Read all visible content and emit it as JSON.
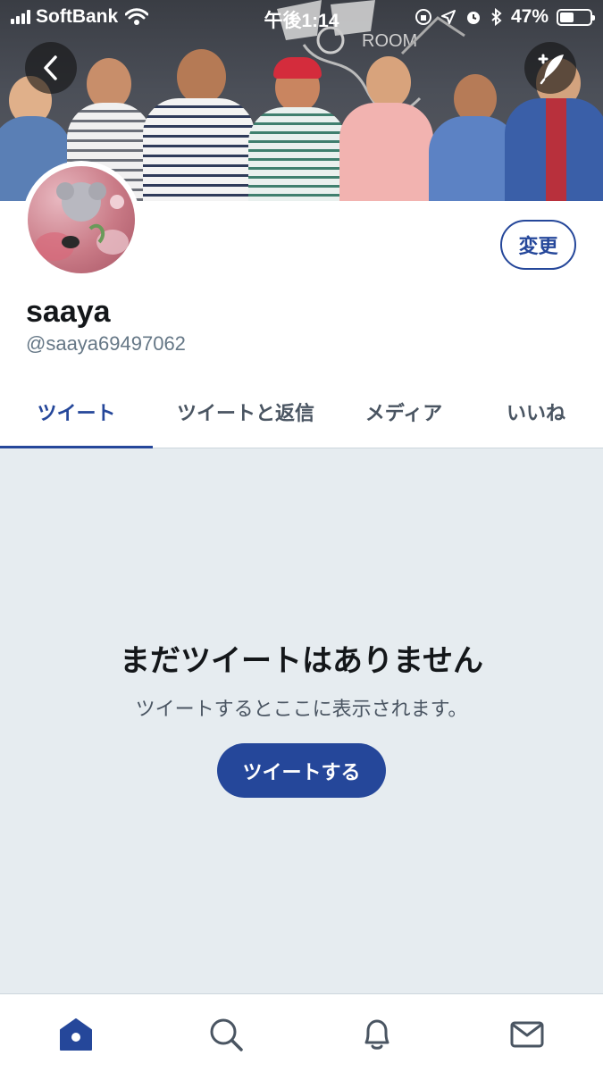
{
  "status_bar": {
    "carrier": "SoftBank",
    "time": "午後1:14",
    "battery_percent_label": "47%",
    "battery_level": 0.47
  },
  "profile": {
    "display_name": "saaya",
    "handle": "@saaya69497062",
    "edit_label": "変更"
  },
  "tabs": [
    {
      "label": "ツイート",
      "active": true
    },
    {
      "label": "ツイートと返信",
      "active": false
    },
    {
      "label": "メディア",
      "active": false
    },
    {
      "label": "いいね",
      "active": false
    }
  ],
  "empty_state": {
    "title": "まだツイートはありません",
    "subtitle": "ツイートするとここに表示されます。",
    "button_label": "ツイートする"
  },
  "bottom_nav": [
    "home-icon",
    "search-icon",
    "notifications-icon",
    "messages-icon"
  ],
  "colors": {
    "accent": "#25479a",
    "empty_background": "#e6ecf0",
    "muted_text": "#657786"
  }
}
